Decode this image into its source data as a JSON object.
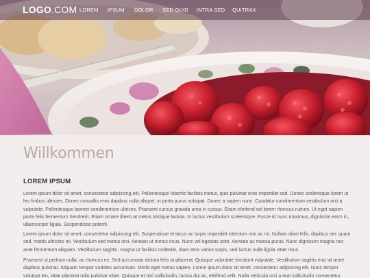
{
  "header": {
    "logo_bold": "LOGO",
    "logo_rest": ".COM",
    "nav": [
      "LOREM",
      "IPSUM",
      "DOLOR",
      "SED QUID",
      "INTRA SED",
      "QUITRAX"
    ]
  },
  "main": {
    "title": "Willkommen",
    "heading": "LOREM IPSUM",
    "paragraphs": [
      "Lorem ipsum dolor sit amet, consectetur adipiscing elit. Pellentesque lobortis facilisis metus, quis pulvinar eros imperdiet sed. Donec scelerisque lorem ut leo finibus ultricies. Donec convallis eros dapibus nulla aliquet, in porta purus volutpat. Donec a sapien nunc. Curabitur condimentum vestibulum orci a vulputate. Pellentesque laoreet condimentum ultrices. Praesent cursus gravida urna in cursus. Etiam eleifend vel lorem rhoncus rutrum. Ut eget sapien porta felis fermentum hendrerit. Etiam ornare libero at metus tristique lacinia. In luctus vestibulum scelerisque. Fusce id nunc maximus, dignissim enim in, ullamcorper ligula. Suspendisse potenti.",
      "Lorem ipsum dolor sit amet, consectetur adipiscing elit. Suspendisse et lacus ac turpis imperdiet interdum non ac mi. Nullam diam felis, dapibus nec quam sed, mattis ultricies mi. Vestibulum sed metus orci. Aenean ut metus risus. Nunc vel egestas ante. Aenean ac massa purus. Nunc dignissim magna nec ante fermentum aliquam. Vestibulum sagittis, magna ut facilisis molestie, diam eros varius turpis, sed luctus nulla ligula vitae risus.",
      "Praesent ut pretium nulla, ac rhoncus ex. Sed accumsan dictum felis at placerat. Quisque vulputate tincidunt vulputate. Vestibulum sagittis erat sit amet dapibus pulvinar. Aliquam tempor sodales accumsan. Morbi eget metus sapien. Lorem ipsum dolor sit amet, consectetur adipiscing elit. Nunc tempor volutpat leo, vitae placerat odio pulvinar vitae. Quisque et nisl sollicitudin, luctus dui ac, eleifend velit. Nulla vehicula orci a erat sollicitudin consectetur."
    ]
  },
  "colors": {
    "nav_overlay": "#5c3e4e",
    "title": "#b7aaaa",
    "background": "#f3eded",
    "berry": "#c8202f"
  }
}
